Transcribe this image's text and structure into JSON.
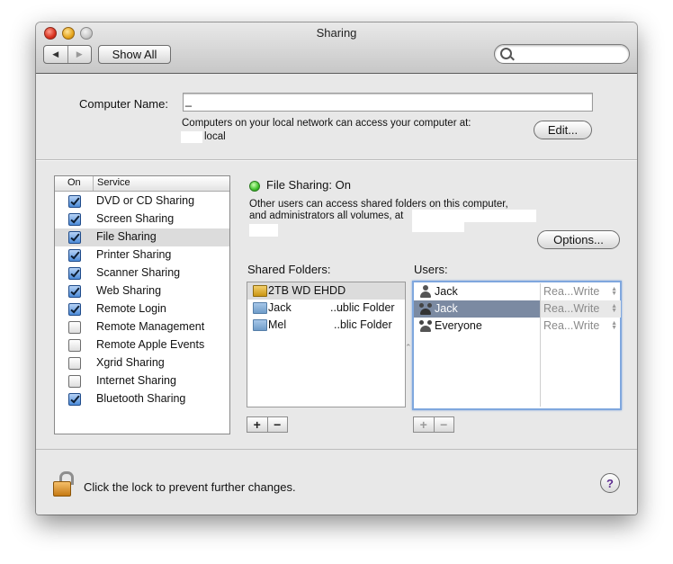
{
  "window": {
    "title": "Sharing"
  },
  "toolbar": {
    "back": "◀",
    "forward": "▶",
    "show_all": "Show All",
    "search_placeholder": ""
  },
  "computer_name": {
    "label": "Computer Name:",
    "value": "_",
    "info": "Computers on your local network can access your computer at:",
    "hostname_suffix": "local",
    "edit_button": "Edit..."
  },
  "services": {
    "col_on": "On",
    "col_service": "Service",
    "items": [
      {
        "name": "DVD or CD Sharing",
        "on": true
      },
      {
        "name": "Screen Sharing",
        "on": true
      },
      {
        "name": "File Sharing",
        "on": true,
        "selected": true
      },
      {
        "name": "Printer Sharing",
        "on": true
      },
      {
        "name": "Scanner Sharing",
        "on": true
      },
      {
        "name": "Web Sharing",
        "on": true
      },
      {
        "name": "Remote Login",
        "on": true
      },
      {
        "name": "Remote Management",
        "on": false
      },
      {
        "name": "Remote Apple Events",
        "on": false
      },
      {
        "name": "Xgrid Sharing",
        "on": false
      },
      {
        "name": "Internet Sharing",
        "on": false
      },
      {
        "name": "Bluetooth Sharing",
        "on": true
      }
    ]
  },
  "file_sharing": {
    "status": "File Sharing: On",
    "desc_line1": "Other users can access shared folders on this computer,",
    "desc_line2": "and administrators all volumes, at",
    "options_button": "Options...",
    "shared_folders_label": "Shared Folders:",
    "users_label": "Users:",
    "folders": [
      {
        "name": "2TB WD EHDD",
        "icon": "drive-icon"
      },
      {
        "name_left": "Jack",
        "name_right": "..ublic Folder",
        "icon": "public-folder-icon"
      },
      {
        "name_left": "Mel",
        "name_right": "..blic Folder",
        "icon": "folder-icon"
      }
    ],
    "users": [
      {
        "name": "Jack",
        "permission": "Rea...Write"
      },
      {
        "name": "Jack",
        "permission": "Rea...Write"
      },
      {
        "name": "Everyone",
        "permission": "Rea...Write"
      }
    ],
    "add": "+",
    "remove": "−"
  },
  "footer": {
    "lock_text": "Click the lock to prevent further changes.",
    "help": "?"
  },
  "colors": {
    "selected_row": "#7b8aa2",
    "status_green": "#3fc12b"
  }
}
